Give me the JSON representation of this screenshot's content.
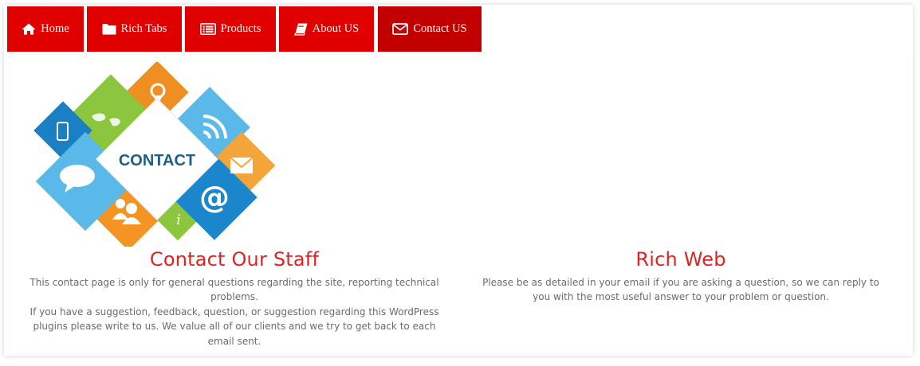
{
  "tabs": [
    {
      "label": "Home",
      "icon": "home-icon"
    },
    {
      "label": "Rich Tabs",
      "icon": "folder-icon"
    },
    {
      "label": "Products",
      "icon": "list-card-icon"
    },
    {
      "label": "About US",
      "icon": "book-icon"
    },
    {
      "label": "Contact US",
      "icon": "envelope-icon",
      "active": true
    }
  ],
  "colors": {
    "tab": "#e00000",
    "tab_active": "#c20000",
    "heading": "#e22222",
    "body_text": "#6b6b6b"
  },
  "hero": {
    "label": "CONTACT"
  },
  "contact_staff": {
    "title": "Contact Our Staff",
    "paragraph1": "This contact page is only for general questions regarding the site, reporting technical problems.",
    "paragraph2": "If you have a suggestion, feedback, question, or suggestion regarding this WordPress plugins please write to us. We value all of our clients and we try to get back to each email sent."
  },
  "rich_web": {
    "title": "Rich Web",
    "paragraph": "Please be as detailed in your email if you are asking a question, so we can reply to you with the most useful answer to your problem or question."
  }
}
